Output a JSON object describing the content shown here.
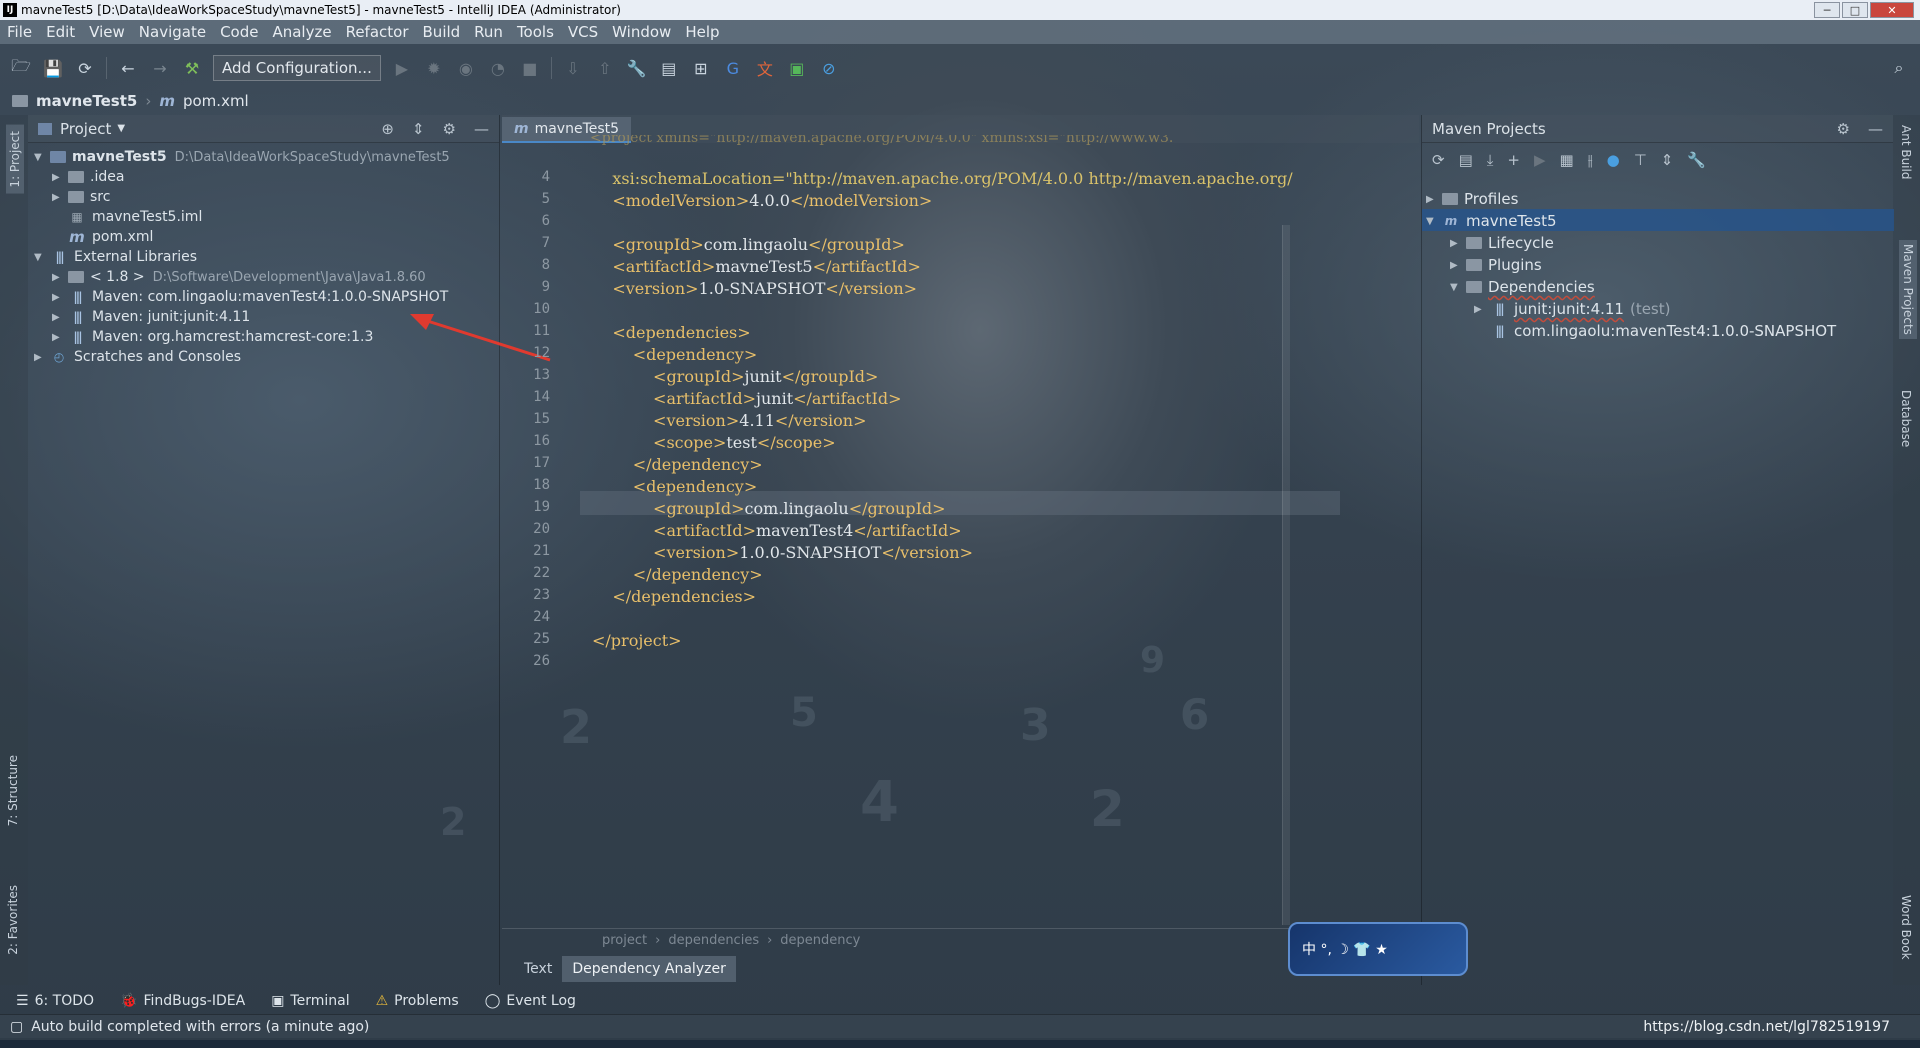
{
  "window": {
    "title": "mavneTest5 [D:\\Data\\IdeaWorkSpaceStudy\\mavneTest5] - mavneTest5 - IntelliJ IDEA (Administrator)",
    "logo_text": "IJ"
  },
  "menu": [
    "File",
    "Edit",
    "View",
    "Navigate",
    "Code",
    "Analyze",
    "Refactor",
    "Build",
    "Run",
    "Tools",
    "VCS",
    "Window",
    "Help"
  ],
  "toolbar": {
    "add_configuration": "Add Configuration..."
  },
  "breadcrumb": {
    "project": "mavneTest5",
    "file": "pom.xml"
  },
  "left_strip": {
    "project_tab": "1: Project",
    "structure_tab": "7: Structure",
    "favorites_tab": "2: Favorites"
  },
  "right_strip": {
    "ant_tab": "Ant Build",
    "maven_tab": "Maven Projects",
    "database_tab": "Database",
    "wordbook_tab": "Word Book"
  },
  "project_panel": {
    "title": "Project",
    "tree": [
      {
        "label": "mavneTest5",
        "path": "D:\\Data\\IdeaWorkSpaceStudy\\mavneTest5",
        "bold": true
      },
      {
        "label": ".idea"
      },
      {
        "label": "src"
      },
      {
        "label": "mavneTest5.iml"
      },
      {
        "label": "pom.xml"
      },
      {
        "label": "External Libraries"
      },
      {
        "label": "< 1.8 >",
        "path": "D:\\Software\\Development\\Java\\Java1.8.60"
      },
      {
        "label": "Maven: com.lingaolu:mavenTest4:1.0.0-SNAPSHOT"
      },
      {
        "label": "Maven: junit:junit:4.11"
      },
      {
        "label": "Maven: org.hamcrest:hamcrest-core:1.3"
      },
      {
        "label": "Scratches and Consoles"
      }
    ]
  },
  "editor": {
    "tab": "mavneTest5",
    "lines": [
      {
        "n": "4",
        "text": "    xsi:schemaLocation=\"http://maven.apache.org/POM/4.0.0 http://maven.apache.org/"
      },
      {
        "n": "5",
        "text": "    <modelVersion>4.0.0</modelVersion>"
      },
      {
        "n": "6",
        "text": ""
      },
      {
        "n": "7",
        "text": "    <groupId>com.lingaolu</groupId>"
      },
      {
        "n": "8",
        "text": "    <artifactId>mavneTest5</artifactId>"
      },
      {
        "n": "9",
        "text": "    <version>1.0-SNAPSHOT</version>"
      },
      {
        "n": "10",
        "text": ""
      },
      {
        "n": "11",
        "text": "    <dependencies>"
      },
      {
        "n": "12",
        "text": "        <dependency>"
      },
      {
        "n": "13",
        "text": "            <groupId>junit</groupId>"
      },
      {
        "n": "14",
        "text": "            <artifactId>junit</artifactId>"
      },
      {
        "n": "15",
        "text": "            <version>4.11</version>"
      },
      {
        "n": "16",
        "text": "            <scope>test</scope>"
      },
      {
        "n": "17",
        "text": "        </dependency>"
      },
      {
        "n": "18",
        "text": "        <dependency>"
      },
      {
        "n": "19",
        "text": "            <groupId>com.lingaolu</groupId>"
      },
      {
        "n": "20",
        "text": "            <artifactId>mavenTest4</artifactId>"
      },
      {
        "n": "21",
        "text": "            <version>1.0.0-SNAPSHOT</version>"
      },
      {
        "n": "22",
        "text": "        </dependency>"
      },
      {
        "n": "23",
        "text": "    </dependencies>"
      },
      {
        "n": "24",
        "text": ""
      },
      {
        "n": "25",
        "text": "</project>"
      },
      {
        "n": "26",
        "text": ""
      }
    ],
    "top_partial": "<project xmlns=\"http://maven.apache.org/POM/4.0.0\" xmlns:xsi=\"http://www.w3.",
    "crumb": [
      "project",
      "dependencies",
      "dependency"
    ],
    "bottom_tabs": [
      "Text",
      "Dependency Analyzer"
    ]
  },
  "maven_panel": {
    "title": "Maven Projects",
    "tree": [
      {
        "label": "Profiles"
      },
      {
        "label": "mavneTest5"
      },
      {
        "label": "Lifecycle"
      },
      {
        "label": "Plugins"
      },
      {
        "label": "Dependencies"
      },
      {
        "label": "junit:junit:4.11",
        "suffix": "(test)"
      },
      {
        "label": "com.lingaolu:mavenTest4:1.0.0-SNAPSHOT"
      }
    ]
  },
  "ime": {
    "text": "中 °, ☽ 👕 ★"
  },
  "bottom_tools": {
    "todo": "6: TODO",
    "findbugs": "FindBugs-IDEA",
    "terminal": "Terminal",
    "problems": "Problems",
    "event_log": "Event Log"
  },
  "status": {
    "message": "Auto build completed with errors (a minute ago)",
    "right": "https://blog.csdn.net/lgl782519197"
  },
  "colors": {
    "tag": "#e8bf6a",
    "selection": "#26548c",
    "arrow": "#e03a2f"
  }
}
